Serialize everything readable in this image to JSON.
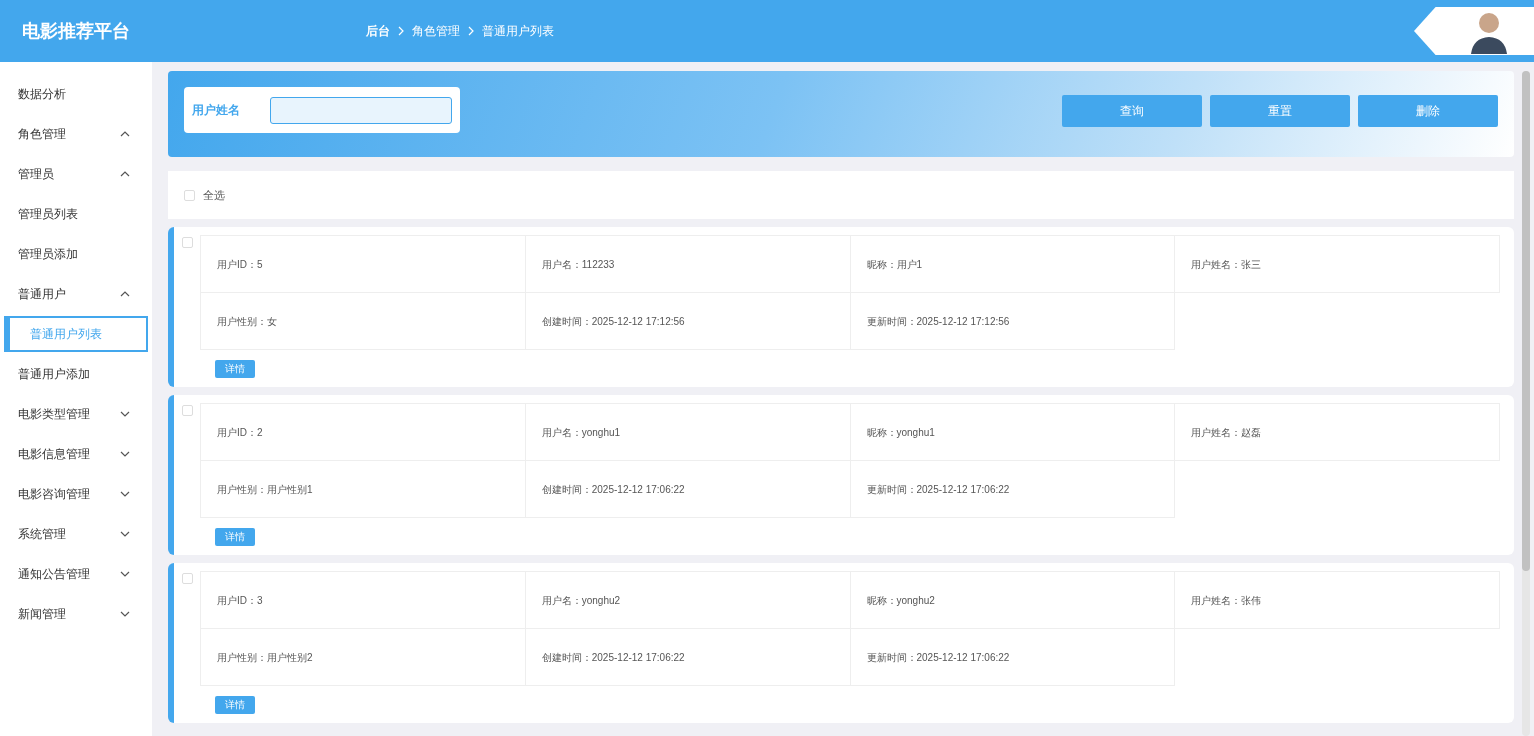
{
  "header": {
    "title": "电影推荐平台",
    "breadcrumb": [
      "后台",
      "角色管理",
      "普通用户列表"
    ]
  },
  "sidebar": {
    "items": [
      {
        "label": "数据分析",
        "selected": false
      },
      {
        "label": "角色管理",
        "selected": false,
        "expanded": true,
        "children": [
          {
            "label": "管理员",
            "selected": false,
            "expanded": true,
            "children": [
              {
                "label": "管理员列表",
                "selected": false
              },
              {
                "label": "管理员添加",
                "selected": false
              }
            ]
          },
          {
            "label": "普通用户",
            "selected": false,
            "expanded": true,
            "children": [
              {
                "label": "普通用户列表",
                "selected": true
              },
              {
                "label": "普通用户添加",
                "selected": false
              }
            ]
          }
        ]
      },
      {
        "label": "电影类型管理",
        "selected": false,
        "expanded": false
      },
      {
        "label": "电影信息管理",
        "selected": false,
        "expanded": false
      },
      {
        "label": "电影咨询管理",
        "selected": false,
        "expanded": false
      },
      {
        "label": "系统管理",
        "selected": false,
        "expanded": false
      },
      {
        "label": "通知公告管理",
        "selected": false,
        "expanded": false
      },
      {
        "label": "新闻管理",
        "selected": false,
        "expanded": false
      }
    ]
  },
  "search": {
    "label": "用户姓名",
    "buttons": [
      "查询",
      "重置",
      "删除"
    ]
  },
  "select_all": {
    "label": "全选",
    "checked": false
  },
  "cards": [
    {
      "checked": false,
      "cells": [
        "用户ID：5",
        "用户名：112233",
        "昵称：用户1",
        "用户姓名：张三",
        "用户性别：女",
        "创建时间：2025-12-12 17:12:56",
        "更新时间：2025-12-12 17:12:56"
      ],
      "button": "详情"
    },
    {
      "checked": false,
      "cells": [
        "用户ID：2",
        "用户名：yonghu1",
        "昵称：yonghu1",
        "用户姓名：赵磊",
        "用户性别：用户性别1",
        "创建时间：2025-12-12 17:06:22",
        "更新时间：2025-12-12 17:06:22"
      ],
      "button": "详情"
    },
    {
      "checked": false,
      "cells": [
        "用户ID：3",
        "用户名：yonghu2",
        "昵称：yonghu2",
        "用户姓名：张伟",
        "用户性别：用户性别2",
        "创建时间：2025-12-12 17:06:22",
        "更新时间：2025-12-12 17:06:22"
      ],
      "button": "详情"
    }
  ]
}
